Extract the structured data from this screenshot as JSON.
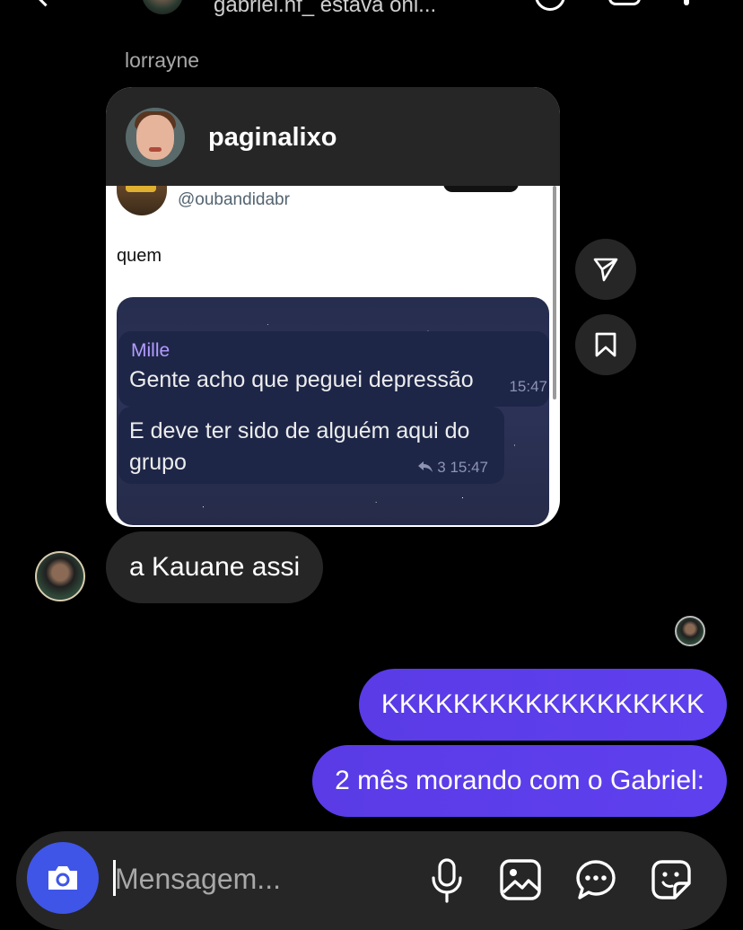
{
  "header": {
    "status_text": "gabriel.nf_ estava onl..."
  },
  "thread": {
    "sender_name": "lorrayne",
    "shared_post": {
      "username": "paginalixo",
      "tweet_handle": "@oubandidabr",
      "tweet_text": "quem",
      "screenshot_chat": {
        "contact_name": "Mille",
        "message1": "Gente acho que peguei depressão",
        "time1": "15:47",
        "message2": "E deve ter sido de alguém aqui do grupo",
        "reply_count": "3",
        "time2": "15:47"
      }
    },
    "received_message": "a Kauane assi",
    "sent_messages": [
      "KKKKKKKKKKKKKKKKKK",
      "2 mês morando com o Gabriel:"
    ]
  },
  "composer": {
    "placeholder": "Mensagem..."
  },
  "colors": {
    "background": "#000000",
    "received_bubble": "#262626",
    "sent_bubble": "#5b3cf0",
    "camera_button": "#3f55e8"
  },
  "icons": {
    "share": "paper-plane-icon",
    "save": "bookmark-icon",
    "camera": "camera-icon",
    "mic": "microphone-icon",
    "gallery": "image-icon",
    "chat": "chat-bubble-icon",
    "sticker": "sticker-icon"
  }
}
